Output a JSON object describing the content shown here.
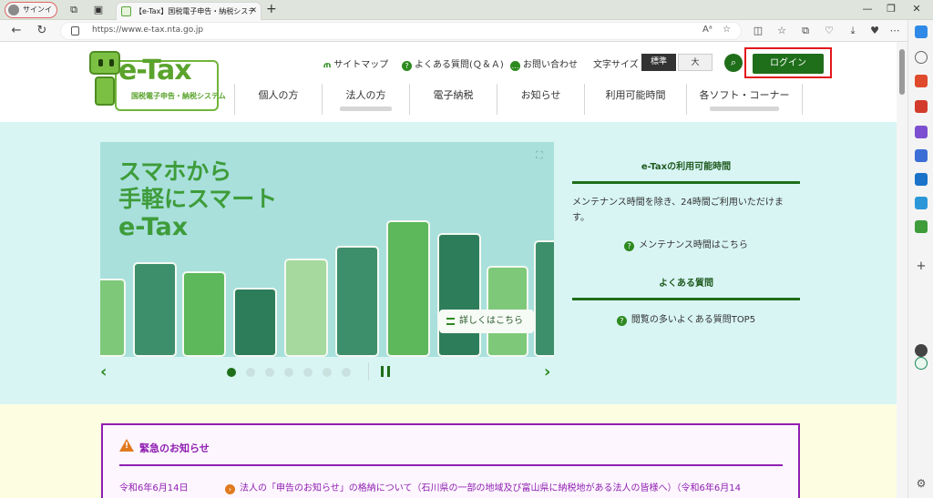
{
  "browser": {
    "profile_label": "サインイン",
    "tab_title": "【e-Tax】国税電子申告・納税システ",
    "url": "https://www.e-tax.nta.go.jp"
  },
  "site": {
    "logo_text": "e-Tax",
    "logo_sub": "国税電子申告・納税システム"
  },
  "util_links": [
    {
      "label": "サイトマップ"
    },
    {
      "label": "よくある質問(Ｑ＆Ａ)"
    },
    {
      "label": "お問い合わせ"
    }
  ],
  "font_size": {
    "label": "文字サイズ",
    "standard": "標準",
    "large": "大"
  },
  "login_label": "ログイン",
  "global_nav": [
    {
      "label": "個人の方"
    },
    {
      "label": "法人の方"
    },
    {
      "label": "電子納税"
    },
    {
      "label": "お知らせ"
    },
    {
      "label": "利用可能時間"
    },
    {
      "label": "各ソフト・コーナー"
    }
  ],
  "hero": {
    "line1": "スマホから",
    "line2": "手軽にスマート",
    "line3": "e-Tax",
    "detail_label": "詳しくはこちら"
  },
  "info": {
    "title1": "e-Taxの利用可能時間",
    "text1": "メンテナンス時間を除き、24時間ご利用いただけます。",
    "link1": "メンテナンス時間はこちら",
    "title2": "よくある質問",
    "link2": "閲覧の多いよくある質問TOP5"
  },
  "notice": {
    "title": "緊急のお知らせ",
    "date": "令和6年6月14日",
    "text": "法人の「申告のお知らせ」の格納について（石川県の一部の地域及び富山県に納税地がある法人の皆様へ）（令和6年6月14"
  },
  "colors": {
    "brand_green": "#1f6e1a",
    "logo_green": "#5aa32c",
    "notice_purple": "#8f1fb0",
    "highlight_red": "#e3171b",
    "hero_bg": "#d8f5f4"
  }
}
